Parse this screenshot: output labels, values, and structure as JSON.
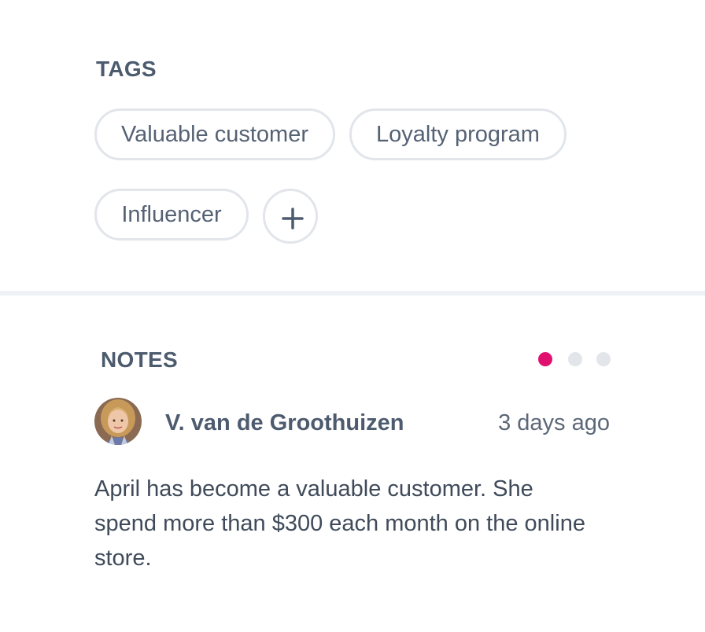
{
  "tags": {
    "title": "TAGS",
    "items": [
      {
        "label": "Valuable customer"
      },
      {
        "label": "Loyalty program"
      },
      {
        "label": "Influencer"
      }
    ],
    "add_icon": "plus-icon"
  },
  "notes": {
    "title": "NOTES",
    "pagination": {
      "total": 3,
      "active_index": 0,
      "active_color": "#e0116e",
      "inactive_color": "#e2e5ea"
    },
    "note": {
      "author": "V. van de Groothuizen",
      "timestamp": "3 days ago",
      "body": "April has become a valuable customer. She spend more than $300 each month on the online store."
    }
  },
  "colors": {
    "accent": "#e0116e",
    "text": "#4d5b6e",
    "border": "#e2e5ea",
    "divider": "#eef1f5"
  }
}
